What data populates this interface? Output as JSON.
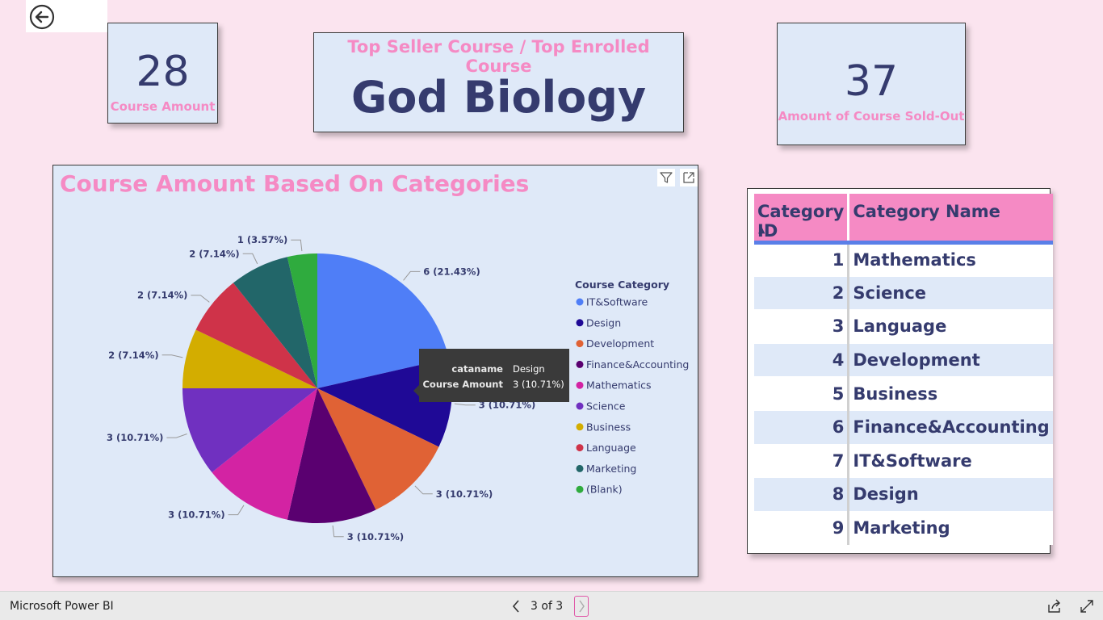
{
  "kpis": {
    "course_amount": {
      "value": "28",
      "label": "Course Amount"
    },
    "top_course": {
      "label": "Top Seller Course / Top Enrolled Course",
      "value": "God Biology"
    },
    "sold_out": {
      "value": "37",
      "label": "Amount of Course Sold-Out"
    }
  },
  "chart": {
    "title": "Course Amount Based On Categories",
    "legend_title": "Course Category",
    "tooltip": {
      "key1": "cataname",
      "val1": "Design",
      "key2": "Course Amount",
      "val2": "3 (10.71%)"
    }
  },
  "chart_data": {
    "type": "pie",
    "title": "Course Amount Based On Categories",
    "legend_title": "Course Category",
    "legend_placement": "right",
    "slices": [
      {
        "name": "IT&Software",
        "value": 6,
        "label": "6 (21.43%)",
        "color": "#4f7ef7"
      },
      {
        "name": "Design",
        "value": 3,
        "label": "3 (10.71%)",
        "color": "#1f0996"
      },
      {
        "name": "Development",
        "value": 3,
        "label": "3 (10.71%)",
        "color": "#e06235"
      },
      {
        "name": "Finance&Accounting",
        "value": 3,
        "label": "3 (10.71%)",
        "color": "#5a0070"
      },
      {
        "name": "Mathematics",
        "value": 3,
        "label": "3 (10.71%)",
        "color": "#d323a3"
      },
      {
        "name": "Science",
        "value": 3,
        "label": "3 (10.71%)",
        "color": "#7030c0"
      },
      {
        "name": "Business",
        "value": 2,
        "label": "2 (7.14%)",
        "color": "#d3ad00"
      },
      {
        "name": "Language",
        "value": 2,
        "label": "2 (7.14%)",
        "color": "#cf3349"
      },
      {
        "name": "Marketing",
        "value": 2,
        "label": "2 (7.14%)",
        "color": "#226669"
      },
      {
        "name": "(Blank)",
        "value": 1,
        "label": "1 (3.57%)",
        "color": "#2fab3e"
      }
    ]
  },
  "table": {
    "headers": {
      "id": "Category ID",
      "name": "Category Name"
    },
    "rows": [
      {
        "id": "1",
        "name": "Mathematics"
      },
      {
        "id": "2",
        "name": "Science"
      },
      {
        "id": "3",
        "name": "Language"
      },
      {
        "id": "4",
        "name": "Development"
      },
      {
        "id": "5",
        "name": "Business"
      },
      {
        "id": "6",
        "name": "Finance&Accounting"
      },
      {
        "id": "7",
        "name": "IT&Software"
      },
      {
        "id": "8",
        "name": "Design"
      },
      {
        "id": "9",
        "name": "Marketing"
      }
    ]
  },
  "statusbar": {
    "brand": "Microsoft Power BI",
    "page": "3 of 3"
  },
  "icons": {
    "back": "back-arrow-icon",
    "filter": "filter-icon",
    "focus": "focus-mode-icon",
    "prev": "chevron-left-icon",
    "next": "chevron-right-icon",
    "share": "share-icon",
    "fullscreen": "fullscreen-icon"
  }
}
